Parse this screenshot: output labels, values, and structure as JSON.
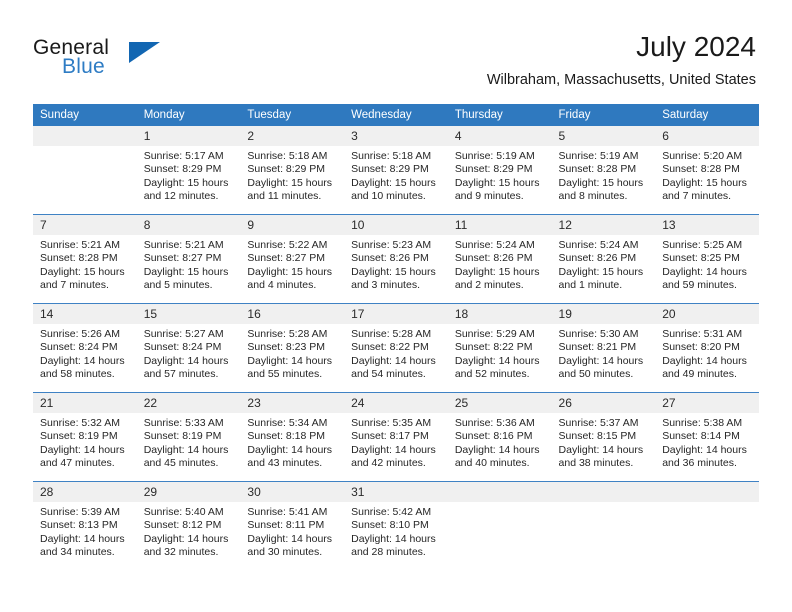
{
  "brand": {
    "name_part1": "General",
    "name_part2": "Blue",
    "accent_color": "#2e7cc4",
    "triangle_color": "#1266b2"
  },
  "header": {
    "title": "July 2024",
    "location": "Wilbraham, Massachusetts, United States",
    "header_bg_color": "#2f79bf",
    "daynum_bg_color": "#f0f0f0"
  },
  "weekday_headers": [
    "Sunday",
    "Monday",
    "Tuesday",
    "Wednesday",
    "Thursday",
    "Friday",
    "Saturday"
  ],
  "weeks": [
    [
      {
        "day": "",
        "lines": []
      },
      {
        "day": "1",
        "lines": [
          "Sunrise: 5:17 AM",
          "Sunset: 8:29 PM",
          "Daylight: 15 hours",
          "and 12 minutes."
        ]
      },
      {
        "day": "2",
        "lines": [
          "Sunrise: 5:18 AM",
          "Sunset: 8:29 PM",
          "Daylight: 15 hours",
          "and 11 minutes."
        ]
      },
      {
        "day": "3",
        "lines": [
          "Sunrise: 5:18 AM",
          "Sunset: 8:29 PM",
          "Daylight: 15 hours",
          "and 10 minutes."
        ]
      },
      {
        "day": "4",
        "lines": [
          "Sunrise: 5:19 AM",
          "Sunset: 8:29 PM",
          "Daylight: 15 hours",
          "and 9 minutes."
        ]
      },
      {
        "day": "5",
        "lines": [
          "Sunrise: 5:19 AM",
          "Sunset: 8:28 PM",
          "Daylight: 15 hours",
          "and 8 minutes."
        ]
      },
      {
        "day": "6",
        "lines": [
          "Sunrise: 5:20 AM",
          "Sunset: 8:28 PM",
          "Daylight: 15 hours",
          "and 7 minutes."
        ]
      }
    ],
    [
      {
        "day": "7",
        "lines": [
          "Sunrise: 5:21 AM",
          "Sunset: 8:28 PM",
          "Daylight: 15 hours",
          "and 7 minutes."
        ]
      },
      {
        "day": "8",
        "lines": [
          "Sunrise: 5:21 AM",
          "Sunset: 8:27 PM",
          "Daylight: 15 hours",
          "and 5 minutes."
        ]
      },
      {
        "day": "9",
        "lines": [
          "Sunrise: 5:22 AM",
          "Sunset: 8:27 PM",
          "Daylight: 15 hours",
          "and 4 minutes."
        ]
      },
      {
        "day": "10",
        "lines": [
          "Sunrise: 5:23 AM",
          "Sunset: 8:26 PM",
          "Daylight: 15 hours",
          "and 3 minutes."
        ]
      },
      {
        "day": "11",
        "lines": [
          "Sunrise: 5:24 AM",
          "Sunset: 8:26 PM",
          "Daylight: 15 hours",
          "and 2 minutes."
        ]
      },
      {
        "day": "12",
        "lines": [
          "Sunrise: 5:24 AM",
          "Sunset: 8:26 PM",
          "Daylight: 15 hours",
          "and 1 minute."
        ]
      },
      {
        "day": "13",
        "lines": [
          "Sunrise: 5:25 AM",
          "Sunset: 8:25 PM",
          "Daylight: 14 hours",
          "and 59 minutes."
        ]
      }
    ],
    [
      {
        "day": "14",
        "lines": [
          "Sunrise: 5:26 AM",
          "Sunset: 8:24 PM",
          "Daylight: 14 hours",
          "and 58 minutes."
        ]
      },
      {
        "day": "15",
        "lines": [
          "Sunrise: 5:27 AM",
          "Sunset: 8:24 PM",
          "Daylight: 14 hours",
          "and 57 minutes."
        ]
      },
      {
        "day": "16",
        "lines": [
          "Sunrise: 5:28 AM",
          "Sunset: 8:23 PM",
          "Daylight: 14 hours",
          "and 55 minutes."
        ]
      },
      {
        "day": "17",
        "lines": [
          "Sunrise: 5:28 AM",
          "Sunset: 8:22 PM",
          "Daylight: 14 hours",
          "and 54 minutes."
        ]
      },
      {
        "day": "18",
        "lines": [
          "Sunrise: 5:29 AM",
          "Sunset: 8:22 PM",
          "Daylight: 14 hours",
          "and 52 minutes."
        ]
      },
      {
        "day": "19",
        "lines": [
          "Sunrise: 5:30 AM",
          "Sunset: 8:21 PM",
          "Daylight: 14 hours",
          "and 50 minutes."
        ]
      },
      {
        "day": "20",
        "lines": [
          "Sunrise: 5:31 AM",
          "Sunset: 8:20 PM",
          "Daylight: 14 hours",
          "and 49 minutes."
        ]
      }
    ],
    [
      {
        "day": "21",
        "lines": [
          "Sunrise: 5:32 AM",
          "Sunset: 8:19 PM",
          "Daylight: 14 hours",
          "and 47 minutes."
        ]
      },
      {
        "day": "22",
        "lines": [
          "Sunrise: 5:33 AM",
          "Sunset: 8:19 PM",
          "Daylight: 14 hours",
          "and 45 minutes."
        ]
      },
      {
        "day": "23",
        "lines": [
          "Sunrise: 5:34 AM",
          "Sunset: 8:18 PM",
          "Daylight: 14 hours",
          "and 43 minutes."
        ]
      },
      {
        "day": "24",
        "lines": [
          "Sunrise: 5:35 AM",
          "Sunset: 8:17 PM",
          "Daylight: 14 hours",
          "and 42 minutes."
        ]
      },
      {
        "day": "25",
        "lines": [
          "Sunrise: 5:36 AM",
          "Sunset: 8:16 PM",
          "Daylight: 14 hours",
          "and 40 minutes."
        ]
      },
      {
        "day": "26",
        "lines": [
          "Sunrise: 5:37 AM",
          "Sunset: 8:15 PM",
          "Daylight: 14 hours",
          "and 38 minutes."
        ]
      },
      {
        "day": "27",
        "lines": [
          "Sunrise: 5:38 AM",
          "Sunset: 8:14 PM",
          "Daylight: 14 hours",
          "and 36 minutes."
        ]
      }
    ],
    [
      {
        "day": "28",
        "lines": [
          "Sunrise: 5:39 AM",
          "Sunset: 8:13 PM",
          "Daylight: 14 hours",
          "and 34 minutes."
        ]
      },
      {
        "day": "29",
        "lines": [
          "Sunrise: 5:40 AM",
          "Sunset: 8:12 PM",
          "Daylight: 14 hours",
          "and 32 minutes."
        ]
      },
      {
        "day": "30",
        "lines": [
          "Sunrise: 5:41 AM",
          "Sunset: 8:11 PM",
          "Daylight: 14 hours",
          "and 30 minutes."
        ]
      },
      {
        "day": "31",
        "lines": [
          "Sunrise: 5:42 AM",
          "Sunset: 8:10 PM",
          "Daylight: 14 hours",
          "and 28 minutes."
        ]
      },
      {
        "day": "",
        "lines": []
      },
      {
        "day": "",
        "lines": []
      },
      {
        "day": "",
        "lines": []
      }
    ]
  ]
}
